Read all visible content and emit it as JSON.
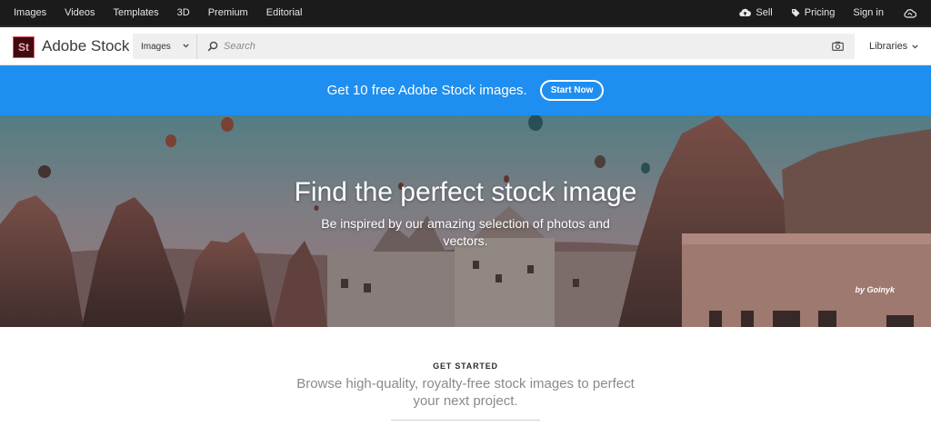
{
  "topnav": {
    "links": [
      "Images",
      "Videos",
      "Templates",
      "3D",
      "Premium",
      "Editorial"
    ],
    "sell": "Sell",
    "pricing": "Pricing",
    "signin": "Sign in"
  },
  "header": {
    "logo_text": "St",
    "brand": "Adobe Stock",
    "search_type": "Images",
    "search_placeholder": "Search",
    "libraries": "Libraries"
  },
  "promo": {
    "text": "Get 10 free Adobe Stock images.",
    "button": "Start Now"
  },
  "hero": {
    "title": "Find the perfect stock image",
    "subtitle": "Be inspired by our amazing selection of photos and vectors.",
    "credit": "by Goinyk"
  },
  "get_started": {
    "label": "GET STARTED",
    "text": "Browse high-quality, royalty-free stock images to perfect your next project."
  },
  "colors": {
    "topnav_bg": "#1b1b1b",
    "promo_bg": "#1e8ff0",
    "logo_bg": "#3f0a10",
    "logo_accent": "#e35b6b"
  },
  "icons": [
    "cloud-upload-icon",
    "tag-icon",
    "creative-cloud-icon",
    "chevron-down-icon",
    "search-icon",
    "camera-icon"
  ]
}
